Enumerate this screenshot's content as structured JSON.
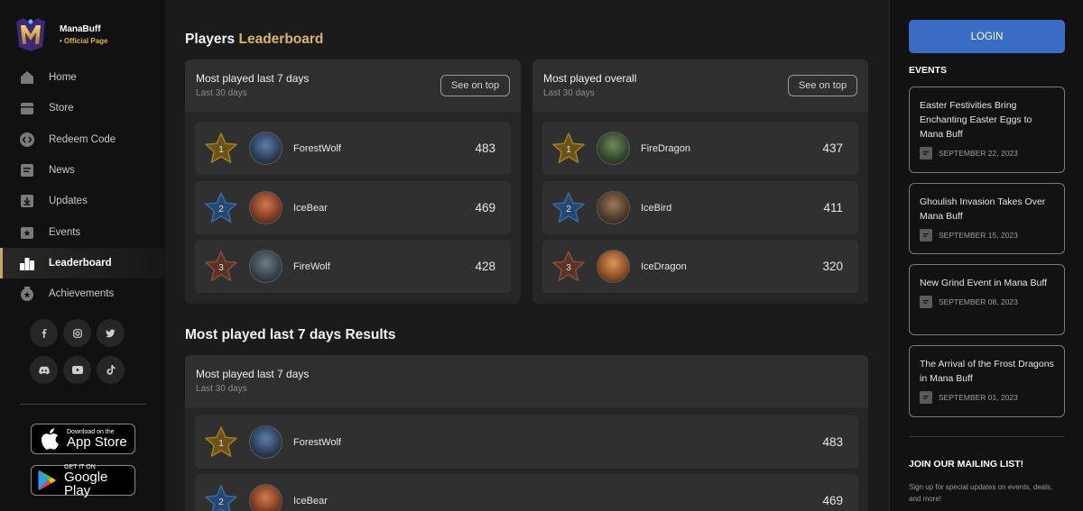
{
  "brand": {
    "name": "ManaBuff",
    "subtitle": "• Official Page"
  },
  "nav": [
    {
      "label": "Home",
      "icon": "home-icon"
    },
    {
      "label": "Store",
      "icon": "store-icon"
    },
    {
      "label": "Redeem Code",
      "icon": "code-icon"
    },
    {
      "label": "News",
      "icon": "news-icon"
    },
    {
      "label": "Updates",
      "icon": "download-icon"
    },
    {
      "label": "Events",
      "icon": "events-icon"
    },
    {
      "label": "Leaderboard",
      "icon": "leaderboard-icon",
      "active": true
    },
    {
      "label": "Achievements",
      "icon": "achievement-icon"
    }
  ],
  "socials": [
    "facebook-icon",
    "instagram-icon",
    "twitter-icon",
    "discord-icon",
    "youtube-icon",
    "tiktok-icon"
  ],
  "stores": {
    "apple": {
      "small": "Download on the",
      "big": "App Store"
    },
    "google": {
      "small": "GET IT ON",
      "big": "Google Play"
    }
  },
  "leaderboard": {
    "title_plain": "Players",
    "title_accent": "Leaderboard",
    "see_label": "See on top",
    "cards": [
      {
        "title": "Most played last 7 days",
        "subtitle": "Last 30 days",
        "rows": [
          {
            "rank": "1",
            "name": "ForestWolf",
            "score": "483"
          },
          {
            "rank": "2",
            "name": "IceBear",
            "score": "469"
          },
          {
            "rank": "3",
            "name": "FireWolf",
            "score": "428"
          }
        ]
      },
      {
        "title": "Most played overall",
        "subtitle": "Last 30 days",
        "rows": [
          {
            "rank": "1",
            "name": "FireDragon",
            "score": "437"
          },
          {
            "rank": "2",
            "name": "IceBird",
            "score": "411"
          },
          {
            "rank": "3",
            "name": "IceDragon",
            "score": "320"
          }
        ]
      }
    ]
  },
  "results": {
    "title": "Most played last 7 days Results",
    "card_title": "Most played last 7 days",
    "card_subtitle": "Last 30 days",
    "rows": [
      {
        "rank": "1",
        "name": "ForestWolf",
        "score": "483"
      },
      {
        "rank": "2",
        "name": "IceBear",
        "score": "469"
      }
    ]
  },
  "right": {
    "login_label": "LOGIN",
    "events_title": "EVENTS",
    "events": [
      {
        "title": "Easter Festivities Bring Enchanting Easter Eggs to Mana Buff",
        "date": "SEPTEMBER 22, 2023"
      },
      {
        "title": "Ghoulish Invasion Takes Over Mana Buff",
        "date": "SEPTEMBER 15, 2023"
      },
      {
        "title": "New Grind Event in Mana Buff",
        "date": "SEPTEMBER 08, 2023"
      },
      {
        "title": "The Arrival of the Frost Dragons in Mana Buff",
        "date": "SEPTEMBER 01, 2023"
      }
    ],
    "mailing_title": "JOIN OUR MAILING LIST!",
    "mailing_text": "Sign up for special updates on events, deals, and more!"
  },
  "colors": {
    "accent_gold": "#d8b56a",
    "login_blue": "#3a6cc4",
    "rank1": "#8a6a1e",
    "rank2": "#2c5a8f",
    "rank3": "#6b3a2c"
  }
}
